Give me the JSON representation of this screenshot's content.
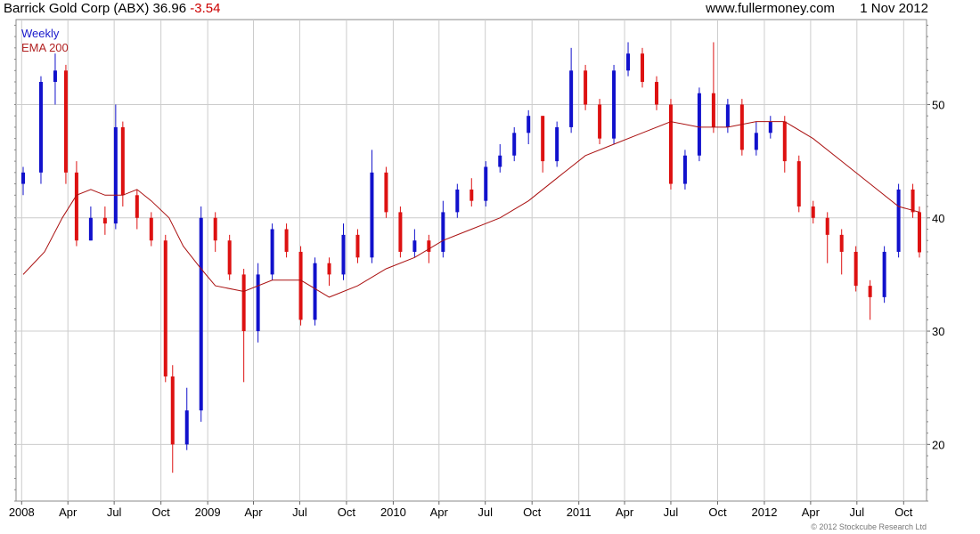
{
  "header": {
    "title": "Barrick Gold Corp (ABX)",
    "price": "36.96",
    "change": "-3.54",
    "site": "www.fullermoney.com",
    "date": "1 Nov 2012"
  },
  "legend": {
    "series1": "Weekly",
    "series2": "EMA 200"
  },
  "copyright": "© 2012 Stockcube Research Ltd",
  "colors": {
    "up": "#1111cc",
    "down": "#dd1111",
    "ema": "#aa1111",
    "grid": "#cccccc"
  },
  "chart_data": {
    "type": "line",
    "title": "Barrick Gold Corp (ABX)",
    "xlabel": "",
    "ylabel": "",
    "ylim": [
      15,
      57.5
    ],
    "x_range": [
      "2008-01-04",
      "2012-11-01"
    ],
    "y_ticks": [
      20,
      30,
      40,
      50
    ],
    "y_axis_side": "right",
    "x_ticks": [
      {
        "date": "2008-01-01",
        "label": "2008"
      },
      {
        "date": "2008-04-01",
        "label": "Apr"
      },
      {
        "date": "2008-07-01",
        "label": "Jul"
      },
      {
        "date": "2008-10-01",
        "label": "Oct"
      },
      {
        "date": "2009-01-01",
        "label": "2009"
      },
      {
        "date": "2009-04-01",
        "label": "Apr"
      },
      {
        "date": "2009-07-01",
        "label": "Jul"
      },
      {
        "date": "2009-10-01",
        "label": "Oct"
      },
      {
        "date": "2010-01-01",
        "label": "2010"
      },
      {
        "date": "2010-04-01",
        "label": "Apr"
      },
      {
        "date": "2010-07-01",
        "label": "Jul"
      },
      {
        "date": "2010-10-01",
        "label": "Oct"
      },
      {
        "date": "2011-01-01",
        "label": "2011"
      },
      {
        "date": "2011-04-01",
        "label": "Apr"
      },
      {
        "date": "2011-07-01",
        "label": "Jul"
      },
      {
        "date": "2011-10-01",
        "label": "Oct"
      },
      {
        "date": "2012-01-01",
        "label": "2012"
      },
      {
        "date": "2012-04-01",
        "label": "Apr"
      },
      {
        "date": "2012-07-01",
        "label": "Jul"
      },
      {
        "date": "2012-10-01",
        "label": "Oct"
      }
    ],
    "grid": true,
    "legend_position": "top-left",
    "series": [
      {
        "name": "Weekly",
        "style": "candlestick",
        "x": [
          "2008-01-04",
          "2008-02-08",
          "2008-03-07",
          "2008-03-28",
          "2008-04-18",
          "2008-05-16",
          "2008-06-13",
          "2008-07-04",
          "2008-07-18",
          "2008-08-15",
          "2008-09-12",
          "2008-10-10",
          "2008-10-24",
          "2008-11-21",
          "2008-12-19",
          "2009-01-16",
          "2009-02-13",
          "2009-03-13",
          "2009-04-10",
          "2009-05-08",
          "2009-06-05",
          "2009-07-03",
          "2009-07-31",
          "2009-08-28",
          "2009-09-25",
          "2009-10-23",
          "2009-11-20",
          "2009-12-18",
          "2010-01-15",
          "2010-02-12",
          "2010-03-12",
          "2010-04-09",
          "2010-05-07",
          "2010-06-04",
          "2010-07-02",
          "2010-07-30",
          "2010-08-27",
          "2010-09-24",
          "2010-10-22",
          "2010-11-19",
          "2010-12-17",
          "2011-01-14",
          "2011-02-11",
          "2011-03-11",
          "2011-04-08",
          "2011-05-06",
          "2011-06-03",
          "2011-07-01",
          "2011-07-29",
          "2011-08-26",
          "2011-09-23",
          "2011-10-21",
          "2011-11-18",
          "2011-12-16",
          "2012-01-13",
          "2012-02-10",
          "2012-03-09",
          "2012-04-06",
          "2012-05-04",
          "2012-06-01",
          "2012-06-29",
          "2012-07-27",
          "2012-08-24",
          "2012-09-21",
          "2012-10-19",
          "2012-11-01"
        ],
        "open": [
          43.0,
          44.0,
          52.0,
          53.0,
          44.0,
          38.0,
          40.0,
          39.5,
          48.0,
          42.0,
          40.0,
          38.0,
          26.0,
          20.0,
          23.0,
          40.0,
          38.0,
          35.0,
          30.0,
          35.0,
          39.0,
          37.0,
          31.0,
          36.0,
          35.0,
          38.5,
          36.5,
          44.0,
          40.5,
          37.0,
          38.0,
          37.0,
          40.5,
          42.5,
          41.5,
          44.5,
          45.5,
          47.5,
          49.0,
          45.0,
          48.0,
          53.0,
          50.0,
          47.0,
          53.0,
          54.5,
          52.0,
          50.0,
          43.0,
          45.5,
          51.0,
          48.0,
          50.0,
          46.0,
          47.5,
          48.5,
          45.0,
          41.0,
          40.0,
          38.5,
          37.0,
          34.0,
          33.0,
          37.0,
          42.5,
          40.5
        ],
        "close": [
          44.0,
          52.0,
          53.0,
          44.0,
          38.0,
          40.0,
          39.5,
          48.0,
          42.0,
          40.0,
          38.0,
          26.0,
          20.0,
          23.0,
          40.0,
          38.0,
          35.0,
          30.0,
          35.0,
          39.0,
          37.0,
          31.0,
          36.0,
          35.0,
          38.5,
          36.5,
          44.0,
          40.5,
          37.0,
          38.0,
          37.0,
          40.5,
          42.5,
          41.5,
          44.5,
          45.5,
          47.5,
          49.0,
          45.0,
          48.0,
          53.0,
          50.0,
          47.0,
          53.0,
          54.5,
          52.0,
          50.0,
          43.0,
          45.5,
          51.0,
          48.0,
          50.0,
          46.0,
          47.5,
          48.5,
          45.0,
          41.0,
          40.0,
          38.5,
          37.0,
          34.0,
          33.0,
          37.0,
          42.5,
          40.5,
          36.96
        ],
        "high": [
          44.5,
          52.5,
          54.5,
          53.5,
          45.0,
          41.0,
          41.0,
          50.0,
          48.5,
          42.5,
          40.5,
          38.5,
          27.0,
          25.0,
          41.0,
          40.5,
          38.5,
          35.5,
          36.0,
          39.5,
          39.5,
          37.5,
          36.5,
          36.5,
          39.5,
          39.0,
          46.0,
          44.5,
          41.0,
          39.0,
          38.5,
          41.5,
          43.0,
          43.5,
          45.0,
          46.5,
          48.0,
          49.5,
          49.0,
          48.5,
          55.0,
          53.5,
          50.5,
          53.5,
          55.5,
          55.0,
          52.5,
          50.5,
          46.0,
          51.5,
          55.5,
          50.5,
          50.5,
          48.5,
          49.0,
          49.0,
          45.5,
          41.5,
          40.5,
          39.0,
          37.5,
          34.5,
          37.5,
          43.0,
          43.0,
          41.0
        ],
        "low": [
          42.0,
          43.0,
          50.0,
          43.0,
          37.5,
          38.0,
          38.5,
          39.0,
          41.0,
          39.0,
          37.5,
          25.5,
          17.5,
          19.5,
          22.0,
          37.0,
          34.5,
          25.5,
          29.0,
          34.5,
          36.5,
          30.5,
          30.5,
          34.0,
          34.5,
          36.0,
          36.0,
          40.0,
          36.5,
          36.5,
          36.0,
          36.5,
          40.0,
          41.0,
          41.0,
          44.0,
          45.0,
          46.5,
          44.0,
          44.5,
          47.5,
          49.5,
          46.5,
          46.5,
          52.5,
          51.5,
          49.5,
          42.5,
          42.5,
          45.0,
          47.5,
          47.5,
          45.5,
          45.5,
          47.0,
          44.0,
          40.5,
          39.5,
          36.0,
          35.0,
          33.5,
          31.0,
          32.5,
          36.5,
          40.0,
          36.5
        ]
      },
      {
        "name": "EMA 200",
        "style": "line",
        "x": [
          "2008-01-04",
          "2008-02-15",
          "2008-03-21",
          "2008-04-18",
          "2008-05-16",
          "2008-06-13",
          "2008-07-18",
          "2008-08-15",
          "2008-09-12",
          "2008-10-17",
          "2008-11-14",
          "2008-12-19",
          "2009-01-16",
          "2009-03-13",
          "2009-05-08",
          "2009-07-03",
          "2009-08-28",
          "2009-10-23",
          "2009-12-18",
          "2010-02-12",
          "2010-04-09",
          "2010-06-04",
          "2010-07-30",
          "2010-09-24",
          "2010-11-19",
          "2011-01-14",
          "2011-03-11",
          "2011-05-06",
          "2011-07-01",
          "2011-08-26",
          "2011-10-21",
          "2011-12-16",
          "2012-02-10",
          "2012-04-06",
          "2012-06-01",
          "2012-07-27",
          "2012-09-21",
          "2012-11-01"
        ],
        "values": [
          35.0,
          37.0,
          40.0,
          42.0,
          42.5,
          42.0,
          42.0,
          42.5,
          41.5,
          40.0,
          37.5,
          35.5,
          34.0,
          33.5,
          34.5,
          34.5,
          33.0,
          34.0,
          35.5,
          36.5,
          38.0,
          39.0,
          40.0,
          41.5,
          43.5,
          45.5,
          46.5,
          47.5,
          48.5,
          48.0,
          48.0,
          48.5,
          48.5,
          47.0,
          45.0,
          43.0,
          41.0,
          40.5
        ]
      }
    ]
  }
}
